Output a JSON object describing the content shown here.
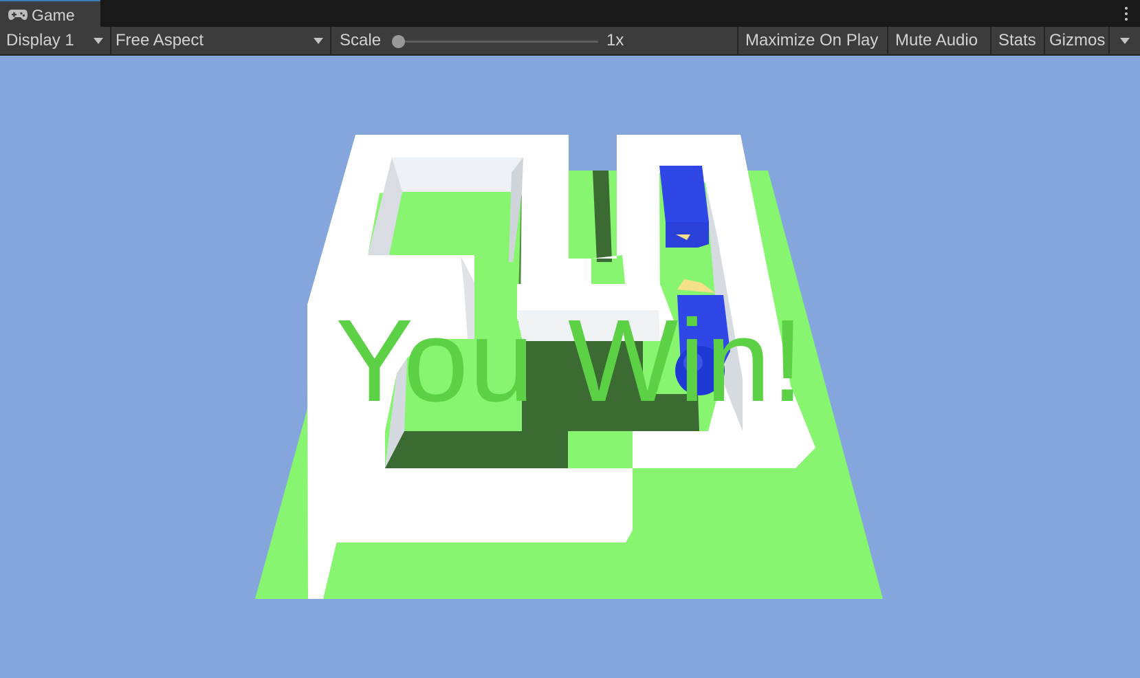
{
  "tab": {
    "title": "Game",
    "icon": "gamepad-icon"
  },
  "toolbar": {
    "display": "Display 1",
    "aspect": "Free Aspect",
    "scale_label": "Scale",
    "scale_value": "1x",
    "scale_slider_level": 0,
    "maximize_on_play": "Maximize On Play",
    "mute_audio": "Mute Audio",
    "stats": "Stats",
    "gizmos": "Gizmos"
  },
  "game": {
    "message": "You Win!",
    "colors": {
      "sky": "#85a5dd",
      "floor": "#87f56f",
      "wall": "#ffffff",
      "player": "#2e47e6",
      "text": "#5dd145"
    }
  }
}
